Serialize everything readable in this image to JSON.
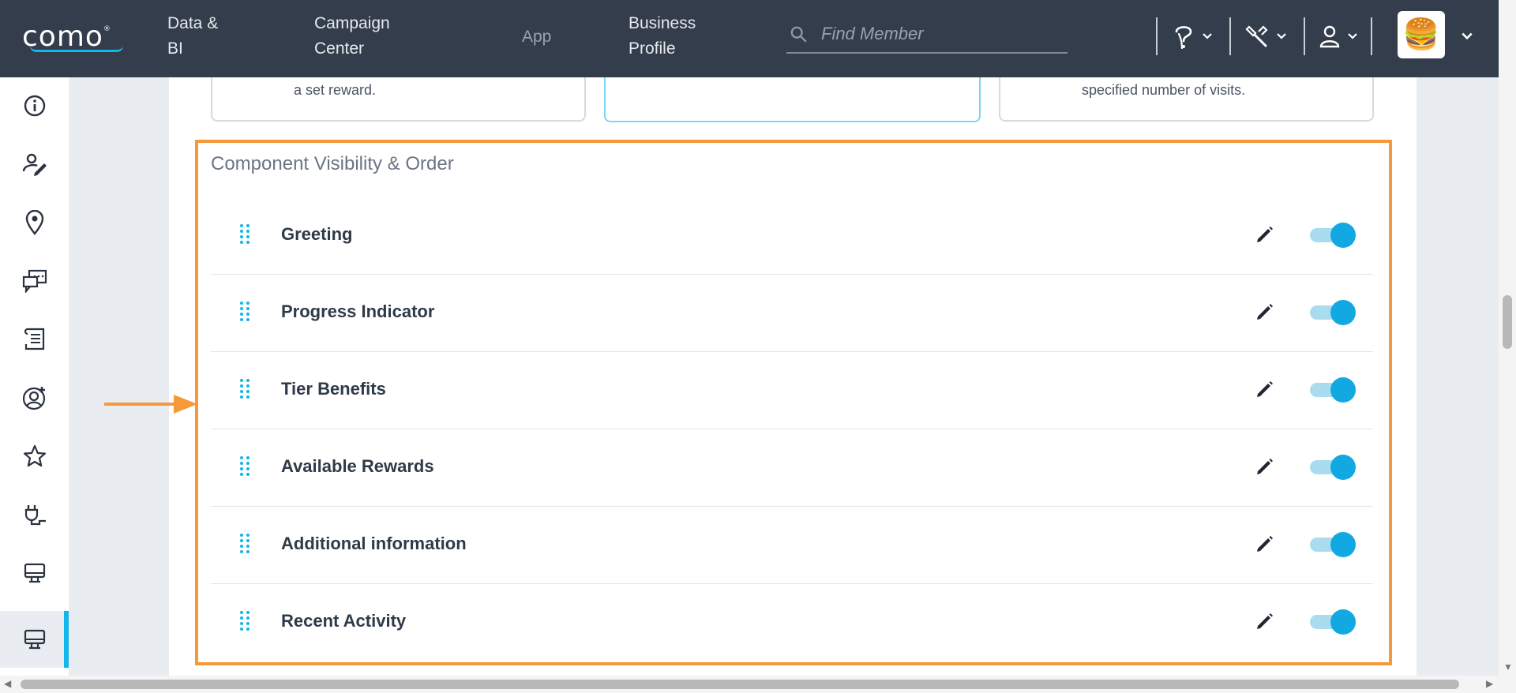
{
  "header": {
    "logo": "como",
    "logo_mark": "®",
    "nav": [
      {
        "line1": "Data &",
        "line2": "BI"
      },
      {
        "line1": "Campaign",
        "line2": "Center"
      },
      {
        "line1": "App",
        "line2": ""
      },
      {
        "line1": "Business",
        "line2": "Profile"
      }
    ],
    "search_placeholder": "Find Member",
    "icons": [
      "help-icon",
      "tools-icon",
      "user-icon"
    ],
    "avatar_emoji": "🍔"
  },
  "sidebar": {
    "items": [
      "info-icon",
      "user-edit-icon",
      "location-pin-icon",
      "chat-icon",
      "receipt-icon",
      "user-add-icon",
      "star-icon",
      "plug-icon",
      "monitor-icon",
      "monitor-icon"
    ],
    "active_index": 9
  },
  "cards": [
    {
      "text_line1": "",
      "text_line2": "a set reward."
    },
    {
      "text_line1": "",
      "text_line2": ""
    },
    {
      "text_line1": "",
      "text_line2": "specified number of visits."
    }
  ],
  "section": {
    "title": "Component Visibility & Order",
    "rows": [
      {
        "label": "Greeting",
        "enabled": true
      },
      {
        "label": "Progress Indicator",
        "enabled": true
      },
      {
        "label": "Tier Benefits",
        "enabled": true
      },
      {
        "label": "Available Rewards",
        "enabled": true
      },
      {
        "label": "Additional information",
        "enabled": true
      },
      {
        "label": "Recent Activity",
        "enabled": true
      }
    ]
  },
  "colors": {
    "topbar": "#333d4b",
    "accent": "#12b6ea",
    "highlight": "#f5993b",
    "toggle_on": "#12a9e2"
  }
}
